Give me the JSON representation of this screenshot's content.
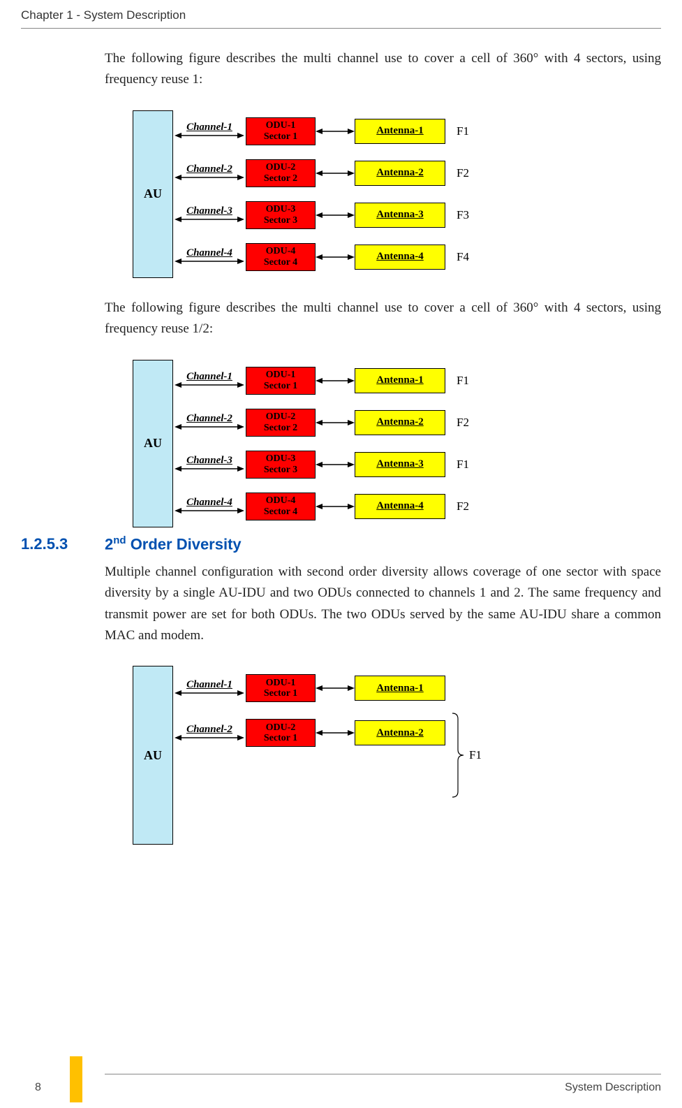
{
  "header": "Chapter 1 - System Description",
  "para1": "The following figure describes the multi channel use to cover a cell of 360° with 4 sectors, using frequency reuse 1:",
  "para2": "The following figure describes the multi channel use to cover a cell of 360° with 4 sectors, using frequency reuse 1/2:",
  "para3": "Multiple channel configuration with second order diversity allows coverage of one sector with space diversity by a single AU-IDU and two ODUs connected to channels 1 and 2. The same frequency and transmit power are set for both ODUs. The two ODUs served by the same AU-IDU share a common MAC and modem.",
  "section": {
    "num": "1.2.5.3",
    "title_prefix": "2",
    "title_sup": "nd",
    "title_suffix": " Order Diversity"
  },
  "au_label": "AU",
  "figure1": [
    {
      "channel": "Channel-1",
      "odu1": "ODU-1",
      "odu2": "Sector 1",
      "antenna": "Antenna-1",
      "freq": "F1"
    },
    {
      "channel": "Channel-2",
      "odu1": "ODU-2",
      "odu2": "Sector 2",
      "antenna": "Antenna-2",
      "freq": "F2"
    },
    {
      "channel": "Channel-3",
      "odu1": "ODU-3",
      "odu2": "Sector 3",
      "antenna": "Antenna-3",
      "freq": "F3"
    },
    {
      "channel": "Channel-4",
      "odu1": "ODU-4",
      "odu2": "Sector 4",
      "antenna": "Antenna-4",
      "freq": "F4"
    }
  ],
  "figure2": [
    {
      "channel": "Channel-1",
      "odu1": "ODU-1",
      "odu2": "Sector 1",
      "antenna": "Antenna-1",
      "freq": "F1"
    },
    {
      "channel": "Channel-2",
      "odu1": "ODU-2",
      "odu2": "Sector 2",
      "antenna": "Antenna-2",
      "freq": "F2"
    },
    {
      "channel": "Channel-3",
      "odu1": "ODU-3",
      "odu2": "Sector 3",
      "antenna": "Antenna-3",
      "freq": "F1"
    },
    {
      "channel": "Channel-4",
      "odu1": "ODU-4",
      "odu2": "Sector 4",
      "antenna": "Antenna-4",
      "freq": "F2"
    }
  ],
  "figure3": [
    {
      "channel": "Channel-1",
      "odu1": "ODU-1",
      "odu2": "Sector 1",
      "antenna": "Antenna-1"
    },
    {
      "channel": "Channel-2",
      "odu1": "ODU-2",
      "odu2": "Sector 1",
      "antenna": "Antenna-2"
    }
  ],
  "figure3_freq": "F1",
  "footer": {
    "page": "8",
    "title": "System Description"
  }
}
